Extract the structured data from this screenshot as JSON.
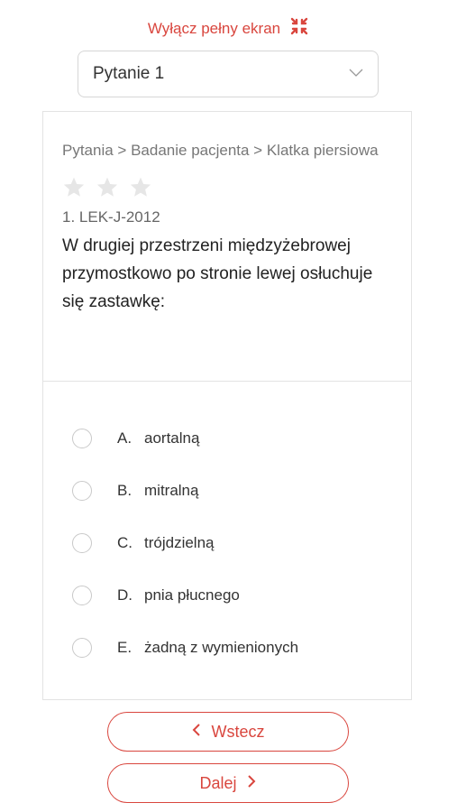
{
  "header": {
    "fullscreen_label": "Wyłącz pełny ekran",
    "fullscreen_icon": "exit-fullscreen-icon"
  },
  "question_select": {
    "selected": "Pytanie 1",
    "icon": "chevron-down-icon"
  },
  "question": {
    "breadcrumb": "Pytania > Badanie pacjenta > Klatka piersiowa",
    "rating": {
      "value": 0,
      "max": 3
    },
    "code": "1. LEK-J-2012",
    "text": "W drugiej przestrzeni międzyżebrowej przymostkowo po stronie lewej osłuchuje się zastawkę:"
  },
  "answers": [
    {
      "letter": "A.",
      "text": "aortalną"
    },
    {
      "letter": "B.",
      "text": "mitralną"
    },
    {
      "letter": "C.",
      "text": "trójdzielną"
    },
    {
      "letter": "D.",
      "text": "pnia płucnego"
    },
    {
      "letter": "E.",
      "text": "żadną z wymienionych"
    }
  ],
  "navigation": {
    "back_label": "Wstecz",
    "next_label": "Dalej"
  },
  "colors": {
    "accent": "#d9463e",
    "star": "#e6e6e6",
    "border": "#e3e3e3"
  }
}
